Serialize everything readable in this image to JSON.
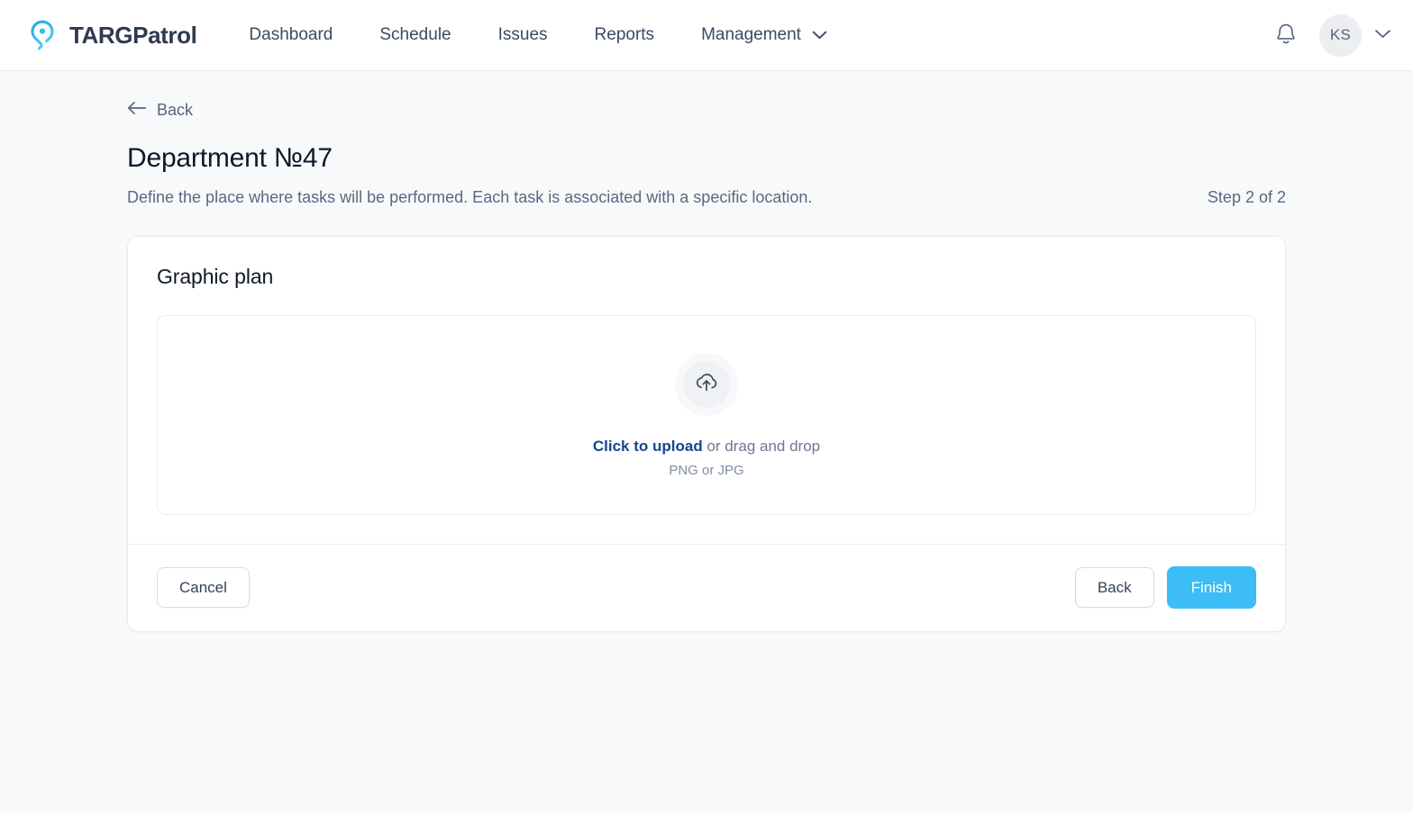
{
  "nav": {
    "brand": {
      "name": "TARGPatrol",
      "logo_icon": "location-pin-icon",
      "logo_colors": {
        "dark": "#1ea7e0",
        "light": "#5ed0ef"
      }
    },
    "links": [
      {
        "label": "Dashboard",
        "name": "nav-link-dashboard",
        "caret": false
      },
      {
        "label": "Schedule",
        "name": "nav-link-schedule",
        "caret": false
      },
      {
        "label": "Issues",
        "name": "nav-link-issues",
        "caret": false
      },
      {
        "label": "Reports",
        "name": "nav-link-reports",
        "caret": false
      },
      {
        "label": "Management",
        "name": "nav-link-management",
        "caret": true
      }
    ],
    "notifications_icon": "bell-icon",
    "avatar_initials": "KS",
    "avatar_caret_icon": "chevron-down-icon"
  },
  "page": {
    "back_label": "Back",
    "back_icon": "arrow-left-icon",
    "title": "Department №47",
    "subtitle": "Define the place where tasks will be performed. Each task is associated with a specific location.",
    "step": "Step 2 of 2"
  },
  "card": {
    "heading": "Graphic plan",
    "dropzone": {
      "icon": "cloud-upload-icon",
      "action_text": "Click to upload",
      "rest_text": " or drag and drop",
      "hint": "PNG or JPG"
    },
    "footer": {
      "cancel_label": "Cancel",
      "back_label": "Back",
      "finish_label": "Finish",
      "primary_color": "#3cbdf5"
    }
  }
}
